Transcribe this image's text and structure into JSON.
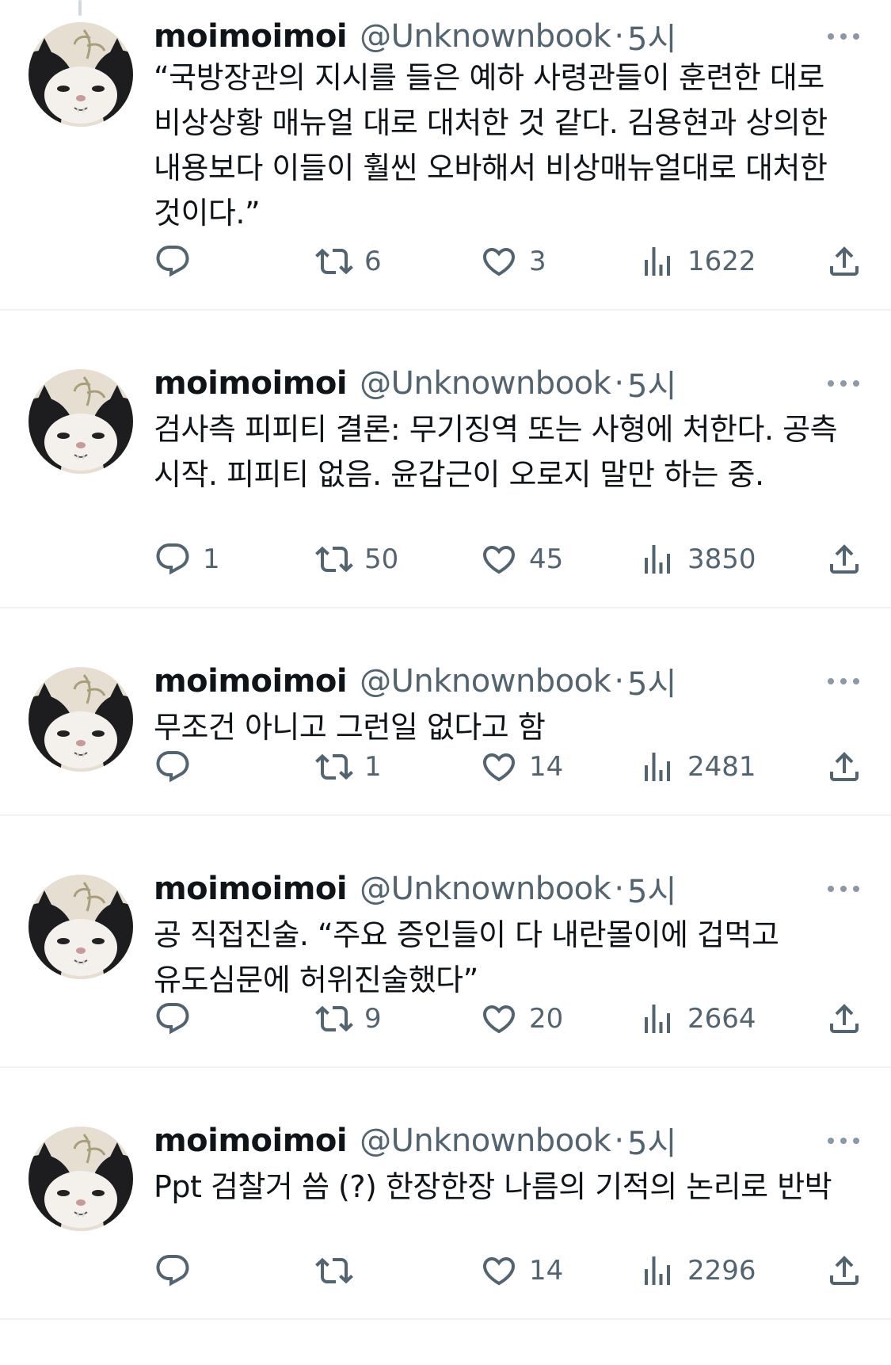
{
  "tweets": [
    {
      "name": "moimoimoi",
      "handle": "@Unknownbook",
      "separator": "·",
      "time": "5시",
      "text": "“국방장관의 지시를 들은 예하 사령관들이 훈련한 대로 비상상황 매뉴얼 대로 대처한 것 같다. 김용현과 상의한 내용보다 이들이 훨씬 오바해서 비상매뉴얼대로 대처한 것이다.”",
      "replies": "",
      "retweets": "6",
      "likes": "3",
      "views": "1622"
    },
    {
      "name": "moimoimoi",
      "handle": "@Unknownbook",
      "separator": "·",
      "time": "5시",
      "text": "검사측 피피티 결론: 무기징역 또는 사형에 처한다. 공측 시작. 피피티 없음. 윤갑근이 오로지 말만 하는 중.",
      "replies": "1",
      "retweets": "50",
      "likes": "45",
      "views": "3850"
    },
    {
      "name": "moimoimoi",
      "handle": "@Unknownbook",
      "separator": "·",
      "time": "5시",
      "text": "무조건 아니고 그런일 없다고 함",
      "replies": "",
      "retweets": "1",
      "likes": "14",
      "views": "2481"
    },
    {
      "name": "moimoimoi",
      "handle": "@Unknownbook",
      "separator": "·",
      "time": "5시",
      "text": "공 직접진술. “주요 증인들이 다 내란몰이에 겁먹고 유도심문에 허위진술했다”",
      "replies": "",
      "retweets": "9",
      "likes": "20",
      "views": "2664"
    },
    {
      "name": "moimoimoi",
      "handle": "@Unknownbook",
      "separator": "·",
      "time": "5시",
      "text": "Ppt 검찰거 씀 (?) 한장한장 나름의 기적의 논리로 반박",
      "replies": "",
      "retweets": "",
      "likes": "14",
      "views": "2296"
    }
  ],
  "icons": {
    "reply": "reply-bubble-icon",
    "retweet": "retweet-icon",
    "like": "heart-icon",
    "views": "views-bar-chart-icon",
    "share": "share-upload-icon",
    "more": "more-dots-icon",
    "avatar": "cat-avatar"
  },
  "colors": {
    "text_primary": "#0f1419",
    "text_secondary": "#536471",
    "divider": "#eff3f4"
  }
}
